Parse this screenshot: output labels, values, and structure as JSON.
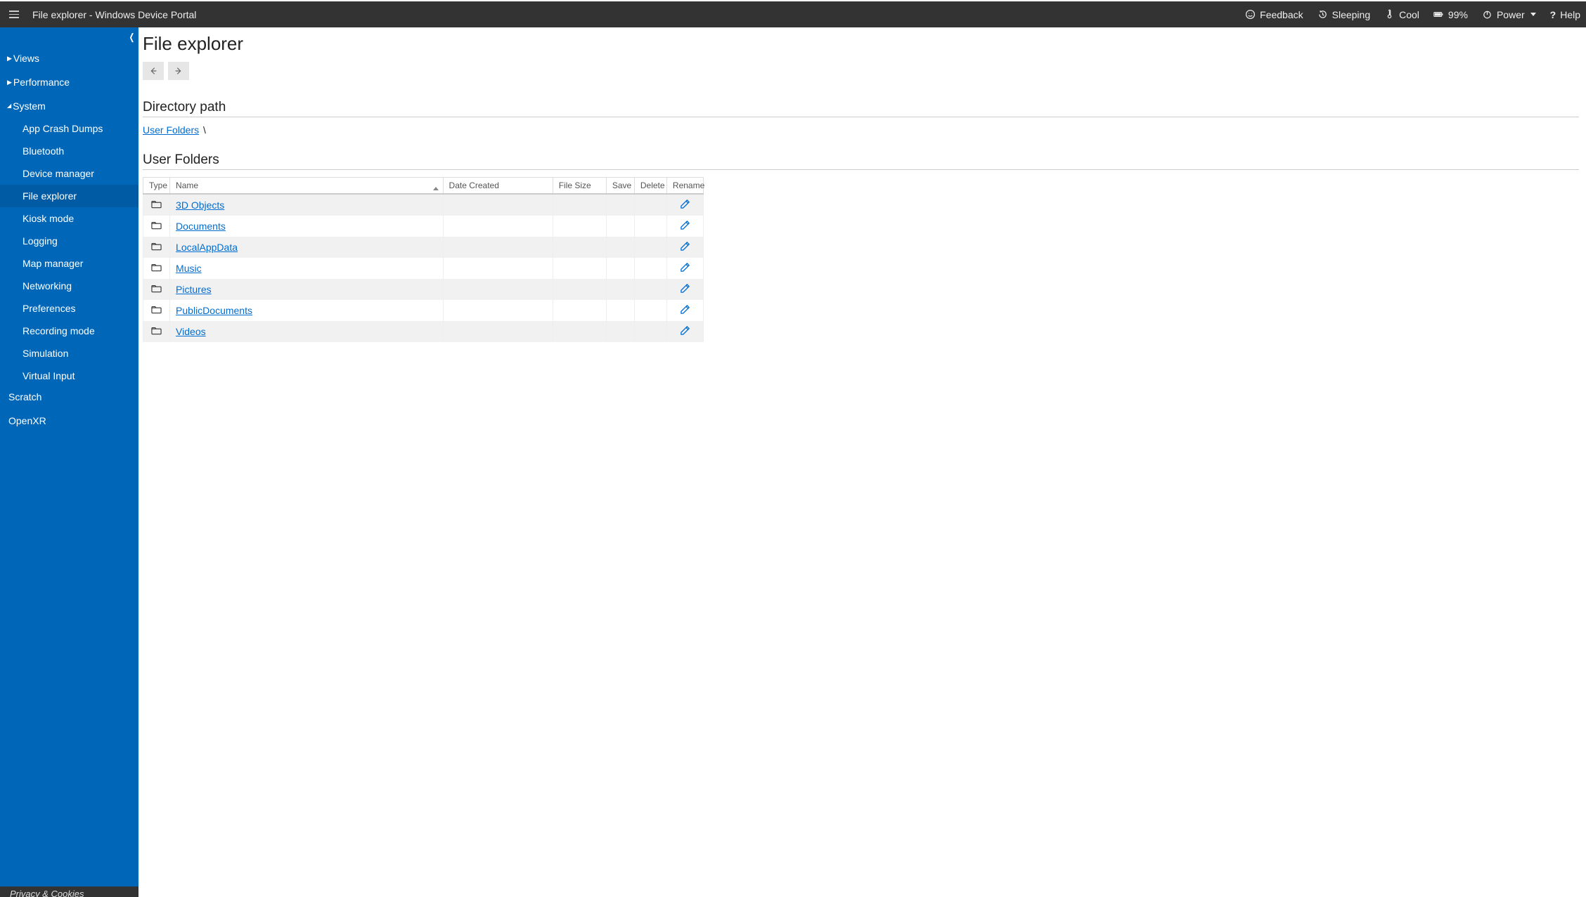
{
  "top": {
    "title": "File explorer - Windows Device Portal",
    "feedback": "Feedback",
    "sleeping": "Sleeping",
    "cool": "Cool",
    "battery": "99%",
    "power": "Power",
    "help": "Help"
  },
  "sidebar": {
    "groups": [
      {
        "label": "Views",
        "expanded": false,
        "items": []
      },
      {
        "label": "Performance",
        "expanded": false,
        "items": []
      },
      {
        "label": "System",
        "expanded": true,
        "items": [
          "App Crash Dumps",
          "Bluetooth",
          "Device manager",
          "File explorer",
          "Kiosk mode",
          "Logging",
          "Map manager",
          "Networking",
          "Preferences",
          "Recording mode",
          "Simulation",
          "Virtual Input"
        ],
        "active_index": 3
      },
      {
        "label": "Scratch",
        "expanded": null,
        "items": []
      },
      {
        "label": "OpenXR",
        "expanded": null,
        "items": []
      }
    ],
    "footer": "Privacy & Cookies"
  },
  "page": {
    "title": "File explorer",
    "section_path_heading": "Directory path",
    "breadcrumb_root": "User Folders",
    "breadcrumb_sep": "\\",
    "section_folders_heading": "User Folders",
    "columns": {
      "type": "Type",
      "name": "Name",
      "date": "Date Created",
      "size": "File Size",
      "save": "Save",
      "delete": "Delete",
      "rename": "Rename"
    },
    "rows": [
      {
        "name": "3D Objects"
      },
      {
        "name": "Documents"
      },
      {
        "name": "LocalAppData"
      },
      {
        "name": "Music"
      },
      {
        "name": "Pictures"
      },
      {
        "name": "PublicDocuments"
      },
      {
        "name": "Videos"
      }
    ]
  }
}
